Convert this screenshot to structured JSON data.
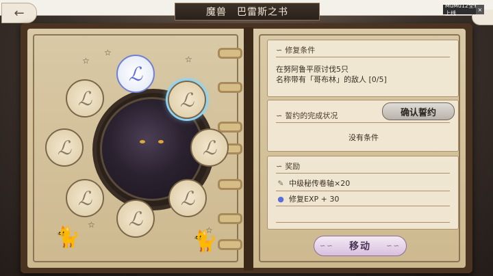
{
  "header": {
    "title": "魔兽　巴雷斯之书",
    "overlay_text": "MuMu12全新上线",
    "overlay_close": "×",
    "back_glyph": "←"
  },
  "seals": [
    {
      "glyph": "ℒ",
      "state": "active"
    },
    {
      "glyph": "ℒ",
      "state": "selected"
    },
    {
      "glyph": "ℒ",
      "state": "inactive"
    },
    {
      "glyph": "ℒ",
      "state": "inactive"
    },
    {
      "glyph": "ℒ",
      "state": "inactive"
    },
    {
      "glyph": "ℒ",
      "state": "inactive"
    },
    {
      "glyph": "ℒ",
      "state": "inactive"
    },
    {
      "glyph": "ℒ",
      "state": "inactive"
    }
  ],
  "repair": {
    "title": "修复条件",
    "line1": "在努阿鲁平原讨伐5只",
    "line2": "名称带有「哥布林」的敌人 [0/5]"
  },
  "pledge": {
    "title": "誓约的完成状况",
    "confirm_label": "确认誓约",
    "status": "没有条件"
  },
  "rewards": {
    "title": "奖励",
    "items": [
      {
        "icon": "scroll-icon",
        "label": "中级秘传卷轴×20"
      },
      {
        "icon": "blue-flame-icon",
        "label": "修复EXP + 30"
      }
    ]
  },
  "move_label": "移动",
  "colors": {
    "active_seal": "#5b6fd8",
    "selected_glow": "#8fd3f4",
    "move_button": "#d9c0df"
  }
}
